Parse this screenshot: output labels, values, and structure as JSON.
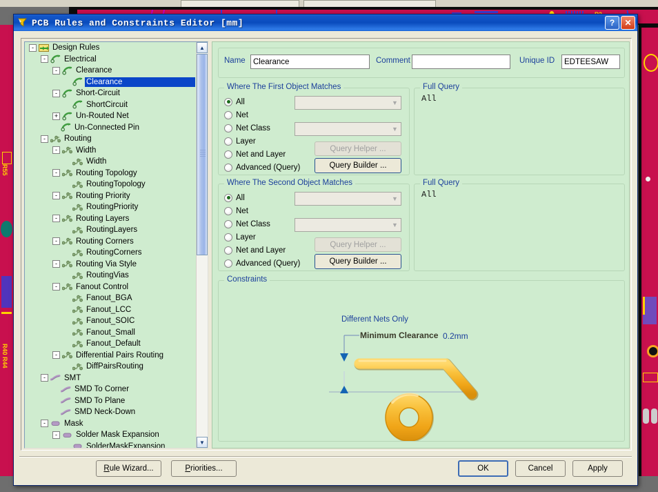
{
  "window": {
    "title": "PCB Rules and Constraints Editor  [mm]",
    "icon": "pcb-rules-icon",
    "help_button": "?",
    "close_button": "✕"
  },
  "tree": {
    "scrollbar": {
      "up": "▲",
      "down": "▼"
    },
    "nodes": [
      {
        "label": "Design Rules",
        "depth": 0,
        "expander": "-",
        "icon": "design-rules-folder-icon",
        "selected": false
      },
      {
        "label": "Electrical",
        "depth": 1,
        "expander": "-",
        "icon": "electrical-rule-icon",
        "selected": false
      },
      {
        "label": "Clearance",
        "depth": 2,
        "expander": "-",
        "icon": "electrical-rule-icon",
        "selected": false
      },
      {
        "label": "Clearance",
        "depth": 3,
        "expander": "",
        "icon": "electrical-rule-icon",
        "selected": true
      },
      {
        "label": "Short-Circuit",
        "depth": 2,
        "expander": "-",
        "icon": "electrical-rule-icon",
        "selected": false
      },
      {
        "label": "ShortCircuit",
        "depth": 3,
        "expander": "",
        "icon": "electrical-rule-icon",
        "selected": false
      },
      {
        "label": "Un-Routed Net",
        "depth": 2,
        "expander": "+",
        "icon": "electrical-rule-icon",
        "selected": false
      },
      {
        "label": "Un-Connected Pin",
        "depth": 2,
        "expander": "",
        "icon": "electrical-rule-icon",
        "selected": false
      },
      {
        "label": "Routing",
        "depth": 1,
        "expander": "-",
        "icon": "routing-rule-icon",
        "selected": false
      },
      {
        "label": "Width",
        "depth": 2,
        "expander": "-",
        "icon": "routing-rule-icon",
        "selected": false
      },
      {
        "label": "Width",
        "depth": 3,
        "expander": "",
        "icon": "routing-rule-icon",
        "selected": false
      },
      {
        "label": "Routing Topology",
        "depth": 2,
        "expander": "-",
        "icon": "routing-rule-icon",
        "selected": false
      },
      {
        "label": "RoutingTopology",
        "depth": 3,
        "expander": "",
        "icon": "routing-rule-icon",
        "selected": false
      },
      {
        "label": "Routing Priority",
        "depth": 2,
        "expander": "-",
        "icon": "routing-rule-icon",
        "selected": false
      },
      {
        "label": "RoutingPriority",
        "depth": 3,
        "expander": "",
        "icon": "routing-rule-icon",
        "selected": false
      },
      {
        "label": "Routing Layers",
        "depth": 2,
        "expander": "-",
        "icon": "routing-rule-icon",
        "selected": false
      },
      {
        "label": "RoutingLayers",
        "depth": 3,
        "expander": "",
        "icon": "routing-rule-icon",
        "selected": false
      },
      {
        "label": "Routing Corners",
        "depth": 2,
        "expander": "-",
        "icon": "routing-rule-icon",
        "selected": false
      },
      {
        "label": "RoutingCorners",
        "depth": 3,
        "expander": "",
        "icon": "routing-rule-icon",
        "selected": false
      },
      {
        "label": "Routing Via Style",
        "depth": 2,
        "expander": "-",
        "icon": "routing-rule-icon",
        "selected": false
      },
      {
        "label": "RoutingVias",
        "depth": 3,
        "expander": "",
        "icon": "routing-rule-icon",
        "selected": false
      },
      {
        "label": "Fanout Control",
        "depth": 2,
        "expander": "-",
        "icon": "routing-rule-icon",
        "selected": false
      },
      {
        "label": "Fanout_BGA",
        "depth": 3,
        "expander": "",
        "icon": "routing-rule-icon",
        "selected": false
      },
      {
        "label": "Fanout_LCC",
        "depth": 3,
        "expander": "",
        "icon": "routing-rule-icon",
        "selected": false
      },
      {
        "label": "Fanout_SOIC",
        "depth": 3,
        "expander": "",
        "icon": "routing-rule-icon",
        "selected": false
      },
      {
        "label": "Fanout_Small",
        "depth": 3,
        "expander": "",
        "icon": "routing-rule-icon",
        "selected": false
      },
      {
        "label": "Fanout_Default",
        "depth": 3,
        "expander": "",
        "icon": "routing-rule-icon",
        "selected": false
      },
      {
        "label": "Differential Pairs Routing",
        "depth": 2,
        "expander": "-",
        "icon": "routing-rule-icon",
        "selected": false
      },
      {
        "label": "DiffPairsRouting",
        "depth": 3,
        "expander": "",
        "icon": "routing-rule-icon",
        "selected": false
      },
      {
        "label": "SMT",
        "depth": 1,
        "expander": "-",
        "icon": "smt-rule-icon",
        "selected": false
      },
      {
        "label": "SMD To Corner",
        "depth": 2,
        "expander": "",
        "icon": "smt-rule-icon",
        "selected": false
      },
      {
        "label": "SMD To Plane",
        "depth": 2,
        "expander": "",
        "icon": "smt-rule-icon",
        "selected": false
      },
      {
        "label": "SMD Neck-Down",
        "depth": 2,
        "expander": "",
        "icon": "smt-rule-icon",
        "selected": false
      },
      {
        "label": "Mask",
        "depth": 1,
        "expander": "-",
        "icon": "mask-rule-icon",
        "selected": false
      },
      {
        "label": "Solder Mask Expansion",
        "depth": 2,
        "expander": "-",
        "icon": "mask-rule-icon",
        "selected": false
      },
      {
        "label": "SolderMaskExpansion",
        "depth": 3,
        "expander": "",
        "icon": "mask-rule-icon",
        "selected": false
      }
    ]
  },
  "form": {
    "name_label": "Name",
    "name_value": "Clearance",
    "comment_label": "Comment",
    "comment_value": "",
    "comment_placeholder": "",
    "unique_id_label": "Unique ID",
    "unique_id_value": "EDTEESAW"
  },
  "first_object": {
    "title": "Where The First Object Matches",
    "options": [
      "All",
      "Net",
      "Net Class",
      "Layer",
      "Net and Layer",
      "Advanced (Query)"
    ],
    "selected": "All",
    "net_combo_value": "",
    "netclass_combo_value": "",
    "query_helper_label": "Query Helper ...",
    "query_helper_enabled": false,
    "query_builder_label": "Query Builder ...",
    "full_query_title": "Full Query",
    "full_query_text": "All"
  },
  "second_object": {
    "title": "Where The Second Object Matches",
    "options": [
      "All",
      "Net",
      "Net Class",
      "Layer",
      "Net and Layer",
      "Advanced (Query)"
    ],
    "selected": "All",
    "net_combo_value": "",
    "netclass_combo_value": "",
    "query_helper_label": "Query Helper ...",
    "query_helper_enabled": false,
    "query_builder_label": "Query Builder ...",
    "full_query_title": "Full Query",
    "full_query_text": "All"
  },
  "constraints": {
    "title": "Constraints",
    "different_nets_only_label": "Different Nets Only",
    "minimum_clearance_label": "Minimum Clearance",
    "minimum_clearance_value": "0.2mm"
  },
  "footer": {
    "rule_wizard": "Rule Wizard...",
    "priorities": "Priorities...",
    "ok": "OK",
    "cancel": "Cancel",
    "apply": "Apply"
  },
  "background": {
    "designators": [
      "R55",
      "R40 R44",
      "P2"
    ]
  },
  "colors": {
    "titlebar_blue": "#0a4bbd",
    "panel_green": "#cfeccf",
    "dialog_face": "#ece9d8",
    "selection_blue": "#0a46c8",
    "label_blue": "#1b3f9b",
    "trace_gold": "#f5a623",
    "board_crimson": "#c8104e"
  }
}
